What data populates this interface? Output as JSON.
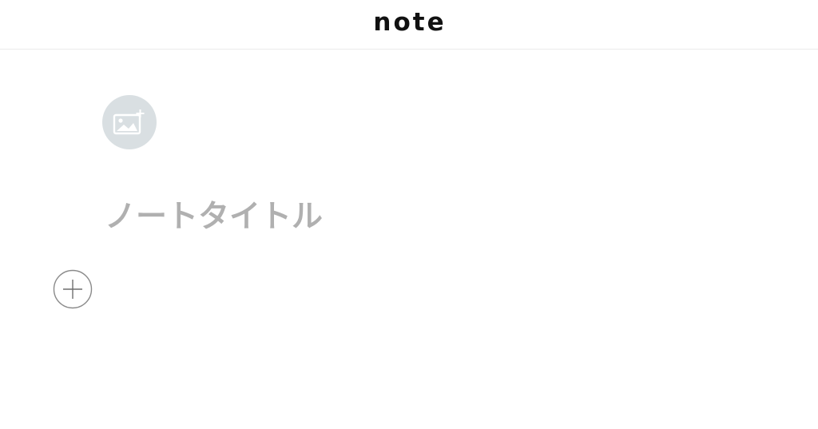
{
  "header": {
    "logo_text": "note"
  },
  "editor": {
    "eyecatch_button_icon": "image-plus-icon",
    "title_placeholder": "ノートタイトル",
    "block_add_icon": "plus-circle-icon"
  },
  "colors": {
    "logo": "#111111",
    "title_placeholder": "#b0b0b0",
    "eyecatch_bg": "#d9dfe2",
    "eyecatch_icon": "#ffffff",
    "plus_circle": "#8a8a8a",
    "header_border": "#ebebeb"
  }
}
